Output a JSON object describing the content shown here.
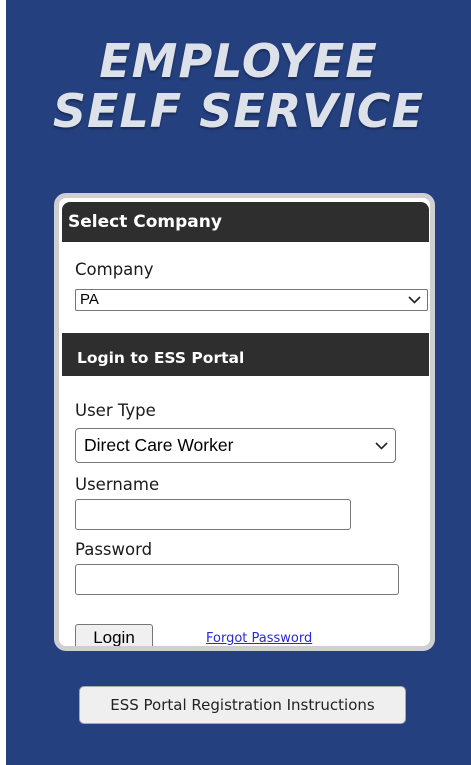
{
  "header": {
    "title_line1": "EMPLOYEE",
    "title_line2": "SELF SERVICE"
  },
  "company_section": {
    "heading": "Select Company",
    "company_label": "Company",
    "company_selected": "PA"
  },
  "login_section": {
    "heading": "Login to ESS Portal",
    "user_type_label": "User Type",
    "user_type_selected": "Direct Care Worker",
    "username_label": "Username",
    "username_value": "",
    "password_label": "Password",
    "password_value": "",
    "login_button": "Login",
    "forgot_password_link": "Forgot Password"
  },
  "footer": {
    "registration_button": "ESS Portal Registration Instructions"
  },
  "colors": {
    "page_background": "#25407f",
    "section_header": "#2e2e2e",
    "card_border": "#cfcfd1",
    "link": "#2929d6",
    "title_text": "#dde1ea"
  },
  "icons": {
    "company_select": "chevron-down-icon",
    "user_type_select": "chevron-down-icon"
  }
}
